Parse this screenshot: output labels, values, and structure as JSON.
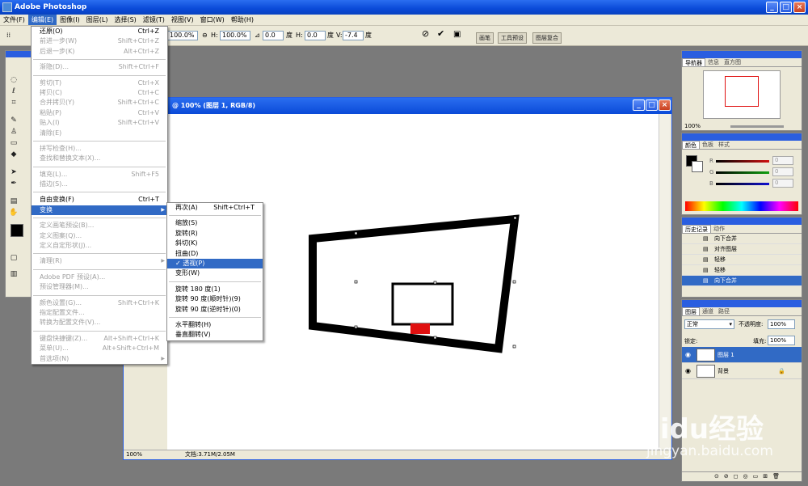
{
  "app": {
    "title": "Adobe Photoshop"
  },
  "menubar": [
    "文件(F)",
    "编辑(E)",
    "图像(I)",
    "图层(L)",
    "选择(S)",
    "滤镜(T)",
    "视图(V)",
    "窗口(W)",
    "帮助(H)"
  ],
  "options": {
    "w_val": "100.0%",
    "h_label": "H:",
    "h_val": "100.0%",
    "angle_val": "0.0",
    "angle_unit": "度",
    "hskew_label": "H:",
    "hskew_val": "0.0",
    "hskew_unit": "度",
    "v_label": "V:",
    "v_val": "-7.4",
    "v_unit": "度"
  },
  "palette_well": [
    "画笔",
    "工具预设",
    "图层复合"
  ],
  "edit_menu": [
    {
      "label": "还原(O)",
      "shortcut": "Ctrl+Z",
      "disabled": false
    },
    {
      "label": "前进一步(W)",
      "shortcut": "Shift+Ctrl+Z",
      "disabled": true
    },
    {
      "label": "后退一步(K)",
      "shortcut": "Alt+Ctrl+Z",
      "disabled": true
    },
    {
      "sep": true
    },
    {
      "label": "渐隐(D)...",
      "shortcut": "Shift+Ctrl+F",
      "disabled": true
    },
    {
      "sep": true
    },
    {
      "label": "剪切(T)",
      "shortcut": "Ctrl+X",
      "disabled": true
    },
    {
      "label": "拷贝(C)",
      "shortcut": "Ctrl+C",
      "disabled": true
    },
    {
      "label": "合并拷贝(Y)",
      "shortcut": "Shift+Ctrl+C",
      "disabled": true
    },
    {
      "label": "粘贴(P)",
      "shortcut": "Ctrl+V",
      "disabled": true
    },
    {
      "label": "贴入(I)",
      "shortcut": "Shift+Ctrl+V",
      "disabled": true
    },
    {
      "label": "清除(E)",
      "shortcut": "",
      "disabled": true
    },
    {
      "sep": true
    },
    {
      "label": "拼写检查(H)...",
      "shortcut": "",
      "disabled": true
    },
    {
      "label": "查找和替换文本(X)...",
      "shortcut": "",
      "disabled": true
    },
    {
      "sep": true
    },
    {
      "label": "填充(L)...",
      "shortcut": "Shift+F5",
      "disabled": true
    },
    {
      "label": "描边(S)...",
      "shortcut": "",
      "disabled": true
    },
    {
      "sep": true
    },
    {
      "label": "自由变换(F)",
      "shortcut": "Ctrl+T",
      "disabled": false
    },
    {
      "label": "变换",
      "shortcut": "",
      "disabled": false,
      "highlight": true,
      "submenu": true
    },
    {
      "sep": true
    },
    {
      "label": "定义画笔预设(B)...",
      "shortcut": "",
      "disabled": true
    },
    {
      "label": "定义图案(Q)...",
      "shortcut": "",
      "disabled": true
    },
    {
      "label": "定义自定形状(J)...",
      "shortcut": "",
      "disabled": true
    },
    {
      "sep": true
    },
    {
      "label": "清理(R)",
      "shortcut": "",
      "disabled": true,
      "submenu": true
    },
    {
      "sep": true
    },
    {
      "label": "Adobe PDF 预设(A)...",
      "shortcut": "",
      "disabled": true
    },
    {
      "label": "预设管理器(M)...",
      "shortcut": "",
      "disabled": true
    },
    {
      "sep": true
    },
    {
      "label": "颜色设置(G)...",
      "shortcut": "Shift+Ctrl+K",
      "disabled": true
    },
    {
      "label": "指定配置文件...",
      "shortcut": "",
      "disabled": true
    },
    {
      "label": "转换为配置文件(V)...",
      "shortcut": "",
      "disabled": true
    },
    {
      "sep": true
    },
    {
      "label": "键盘快捷键(Z)...",
      "shortcut": "Alt+Shift+Ctrl+K",
      "disabled": true
    },
    {
      "label": "菜单(U)...",
      "shortcut": "Alt+Shift+Ctrl+M",
      "disabled": true
    },
    {
      "label": "首选项(N)",
      "shortcut": "",
      "disabled": true,
      "submenu": true
    }
  ],
  "transform_menu": [
    {
      "label": "再次(A)",
      "shortcut": "Shift+Ctrl+T"
    },
    {
      "sep": true
    },
    {
      "label": "缩放(S)"
    },
    {
      "label": "旋转(R)"
    },
    {
      "label": "斜切(K)"
    },
    {
      "label": "扭曲(D)"
    },
    {
      "label": "✓ 透视(P)",
      "highlight": true
    },
    {
      "label": "变形(W)"
    },
    {
      "sep": true
    },
    {
      "label": "旋转 180 度(1)"
    },
    {
      "label": "旋转 90 度(顺时针)(9)"
    },
    {
      "label": "旋转 90 度(逆时针)(0)"
    },
    {
      "sep": true
    },
    {
      "label": "水平翻转(H)"
    },
    {
      "label": "垂直翻转(V)"
    }
  ],
  "document": {
    "title": "@ 100% (图层 1, RGB/8)",
    "zoom": "100%",
    "doc_info": "文档:3.71M/2.05M"
  },
  "navigator": {
    "tabs": [
      "导航器",
      "信息",
      "直方图"
    ],
    "zoom": "100%"
  },
  "color": {
    "tabs": [
      "颜色",
      "色板",
      "样式"
    ],
    "channels": [
      {
        "label": "R",
        "value": "0",
        "color": "#d01010"
      },
      {
        "label": "G",
        "value": "0",
        "color": "#10a010"
      },
      {
        "label": "B",
        "value": "0",
        "color": "#1010d0"
      }
    ]
  },
  "history": {
    "tabs": [
      "历史记录",
      "动作"
    ],
    "items": [
      "向下合并",
      "对齐图层",
      "轻移",
      "轻移",
      "向下合并"
    ]
  },
  "layers": {
    "tabs": [
      "图层",
      "通道",
      "路径"
    ],
    "blend": "正常",
    "opacity_label": "不透明度:",
    "opacity": "100%",
    "lock_label": "锁定:",
    "fill_label": "填充:",
    "fill": "100%",
    "items": [
      {
        "name": "图层 1",
        "selected": true
      },
      {
        "name": "背景",
        "selected": false
      }
    ]
  },
  "watermark": {
    "brand": "Baidu经验",
    "url": "jingyan.baidu.com"
  }
}
